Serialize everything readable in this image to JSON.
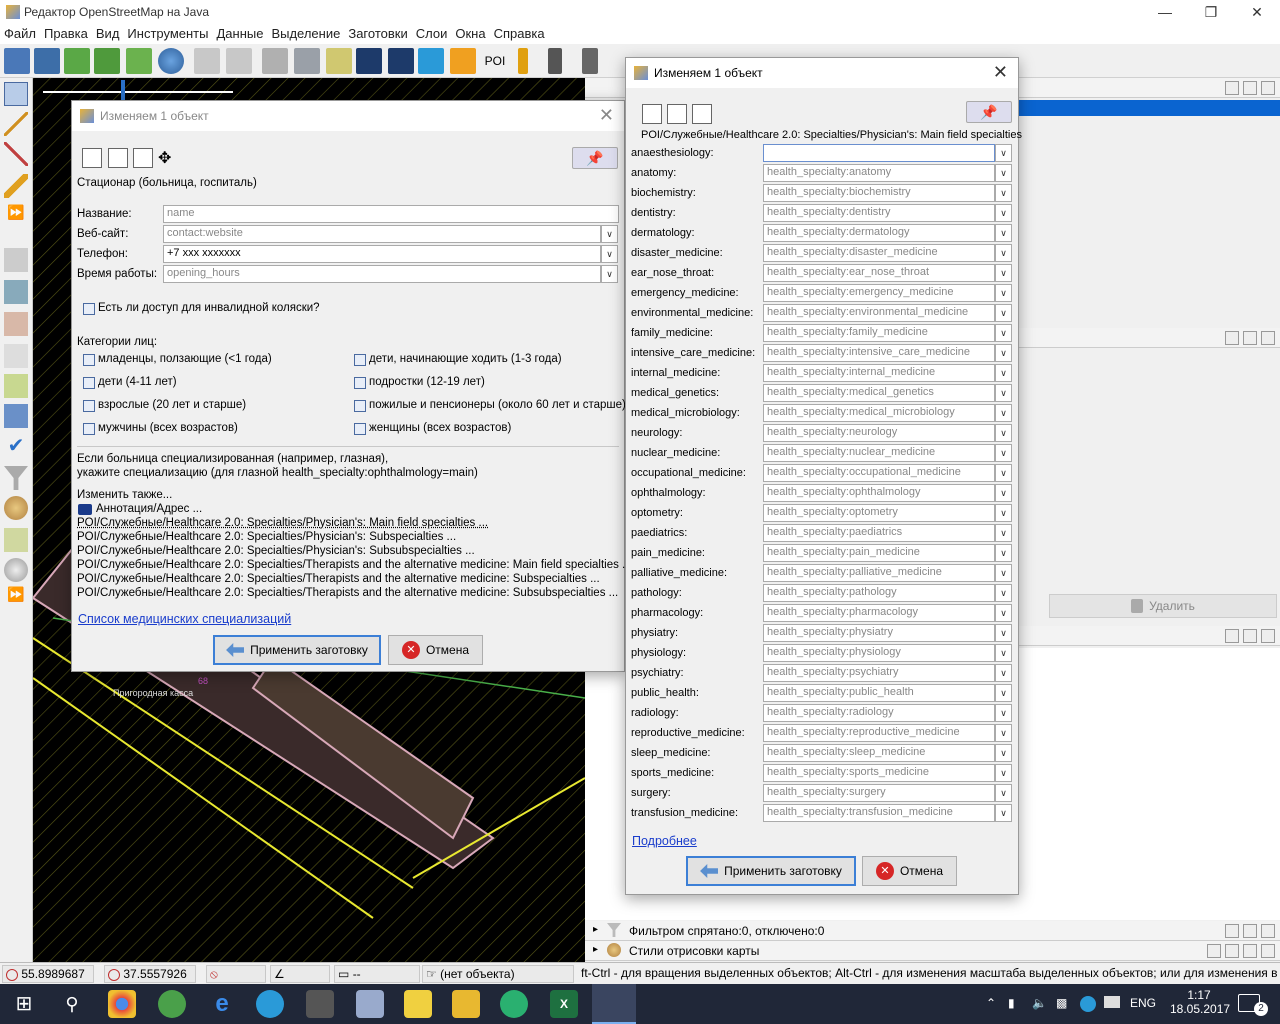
{
  "window": {
    "title": "Редактор OpenStreetMap на Java"
  },
  "menu": [
    "Файл",
    "Правка",
    "Вид",
    "Инструменты",
    "Данные",
    "Выделение",
    "Заготовки",
    "Слои",
    "Окна",
    "Справка"
  ],
  "toolbar": {
    "poi_label": "POI"
  },
  "dialog_left": {
    "title": "Изменяем 1 объект",
    "preset_name": "Стационар (больница, госпиталь)",
    "fields": [
      {
        "label": "Название:",
        "placeholder": "name",
        "value": ""
      },
      {
        "label": "Веб-сайт:",
        "placeholder": "contact:website",
        "value": ""
      },
      {
        "label": "Телефон:",
        "placeholder": "",
        "value": "+7 xxx xxxxxxx"
      },
      {
        "label": "Время работы:",
        "placeholder": "opening_hours",
        "value": ""
      }
    ],
    "wheelchair_label": "Есть ли доступ для инвалидной коляски?",
    "categories_label": "Категории лиц:",
    "categories": [
      "младенцы, ползающие (<1 года)",
      "дети, начинающие ходить (1-3 года)",
      "дети (4-11 лет)",
      "подростки (12-19 лет)",
      "взрослые (20 лет и старше)",
      "пожилые и пенсионеры (около 60 лет и старше)",
      "мужчины (всех возрастов)",
      "женщины (всех возрастов)"
    ],
    "specialization_text_1": "Если больница специализированная (например, глазная),",
    "specialization_text_2": "укажите специализацию (для глазной health_specialty:ophthalmology=main)",
    "also_edit": "Изменить также...",
    "also_items": [
      "Аннотация/Адрес ...",
      "POI/Служебные/Healthcare 2.0: Specialties/Physician's: Main field specialties ...",
      "POI/Служебные/Healthcare 2.0: Specialties/Physician's: Subspecialties ...",
      "POI/Служебные/Healthcare 2.0: Specialties/Physician's: Subsubspecialties ...",
      "POI/Служебные/Healthcare 2.0: Specialties/Therapists and the alternative medicine: Main field specialties ...",
      "POI/Служебные/Healthcare 2.0: Specialties/Therapists and the alternative medicine: Subspecialties ...",
      "POI/Служебные/Healthcare 2.0: Specialties/Therapists and the alternative medicine: Subsubspecialties ..."
    ],
    "link": "Список медицинских специализаций",
    "apply": "Применить заготовку",
    "cancel": "Отмена"
  },
  "dialog_right": {
    "title": "Изменяем 1 объект",
    "preset_path": "POI/Служебные/Healthcare 2.0: Specialties/Physician's: Main field specialties",
    "rows": [
      {
        "label": "anaesthesiology:",
        "placeholder": ""
      },
      {
        "label": "anatomy:",
        "placeholder": "health_specialty:anatomy"
      },
      {
        "label": "biochemistry:",
        "placeholder": "health_specialty:biochemistry"
      },
      {
        "label": "dentistry:",
        "placeholder": "health_specialty:dentistry"
      },
      {
        "label": "dermatology:",
        "placeholder": "health_specialty:dermatology"
      },
      {
        "label": "disaster_medicine:",
        "placeholder": "health_specialty:disaster_medicine"
      },
      {
        "label": "ear_nose_throat:",
        "placeholder": "health_specialty:ear_nose_throat"
      },
      {
        "label": "emergency_medicine:",
        "placeholder": "health_specialty:emergency_medicine"
      },
      {
        "label": "environmental_medicine:",
        "placeholder": "health_specialty:environmental_medicine"
      },
      {
        "label": "family_medicine:",
        "placeholder": "health_specialty:family_medicine"
      },
      {
        "label": "intensive_care_medicine:",
        "placeholder": "health_specialty:intensive_care_medicine"
      },
      {
        "label": "internal_medicine:",
        "placeholder": "health_specialty:internal_medicine"
      },
      {
        "label": "medical_genetics:",
        "placeholder": "health_specialty:medical_genetics"
      },
      {
        "label": "medical_microbiology:",
        "placeholder": "health_specialty:medical_microbiology"
      },
      {
        "label": "neurology:",
        "placeholder": "health_specialty:neurology"
      },
      {
        "label": "nuclear_medicine:",
        "placeholder": "health_specialty:nuclear_medicine"
      },
      {
        "label": "occupational_medicine:",
        "placeholder": "health_specialty:occupational_medicine"
      },
      {
        "label": "ophthalmology:",
        "placeholder": "health_specialty:ophthalmology"
      },
      {
        "label": "optometry:",
        "placeholder": "health_specialty:optometry"
      },
      {
        "label": "paediatrics:",
        "placeholder": "health_specialty:paediatrics"
      },
      {
        "label": "pain_medicine:",
        "placeholder": "health_specialty:pain_medicine"
      },
      {
        "label": "palliative_medicine:",
        "placeholder": "health_specialty:palliative_medicine"
      },
      {
        "label": "pathology:",
        "placeholder": "health_specialty:pathology"
      },
      {
        "label": "pharmacology:",
        "placeholder": "health_specialty:pharmacology"
      },
      {
        "label": "physiatry:",
        "placeholder": "health_specialty:physiatry"
      },
      {
        "label": "physiology:",
        "placeholder": "health_specialty:physiology"
      },
      {
        "label": "psychiatry:",
        "placeholder": "health_specialty:psychiatry"
      },
      {
        "label": "public_health:",
        "placeholder": "health_specialty:public_health"
      },
      {
        "label": "radiology:",
        "placeholder": "health_specialty:radiology"
      },
      {
        "label": "reproductive_medicine:",
        "placeholder": "health_specialty:reproductive_medicine"
      },
      {
        "label": "sleep_medicine:",
        "placeholder": "health_specialty:sleep_medicine"
      },
      {
        "label": "sports_medicine:",
        "placeholder": "health_specialty:sports_medicine"
      },
      {
        "label": "surgery:",
        "placeholder": "health_specialty:surgery"
      },
      {
        "label": "transfusion_medicine:",
        "placeholder": "health_specialty:transfusion_medicine"
      }
    ],
    "link": "Подробнее",
    "apply": "Применить заготовку",
    "cancel": "Отмена"
  },
  "right_panel": {
    "delete_label": "Удалить",
    "filter_label": "Фильтром спрятано:0, отключено:0",
    "styles_label": "Стили отрисовки карты"
  },
  "map": {
    "label_ticket": "Пригородная касса",
    "label_num": "68"
  },
  "status": {
    "lat": "55.8989687",
    "lon": "37.5557926",
    "dist": "--",
    "object": "(нет объекта)",
    "hint": "ft-Ctrl - для вращения выделенных объектов; Alt-Ctrl - для изменения масштаба выделенных объектов; или для изменения выделения"
  },
  "taskbar": {
    "lang": "ENG",
    "time": "1:17",
    "date": "18.05.2017",
    "notif": "2"
  }
}
